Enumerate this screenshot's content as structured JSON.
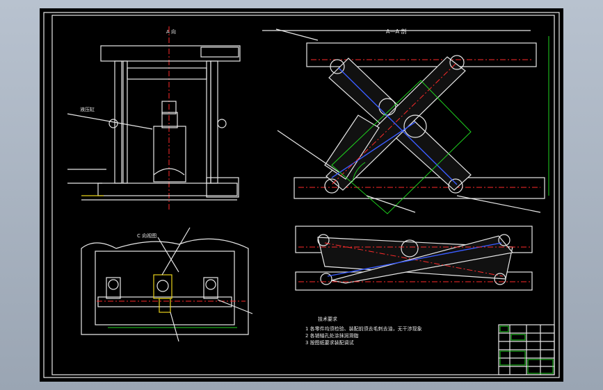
{
  "views": {
    "front_view_label": "C 向视图",
    "section_label": "A—A 剖",
    "arrow_label": "A 向"
  },
  "notes": {
    "title": "技术要求",
    "items": [
      "1 各零件均须检验、装配前须去毛刺去油，无干涉现象",
      "2 各销轴孔处涂抹润滑脂",
      "3 按图纸要求装配调试"
    ]
  },
  "title_block": {
    "rows": 6
  },
  "colors": {
    "sheet": "#000000",
    "outline": "#e8e8e8",
    "center_line": "#ff2a2a",
    "hydraulic": "#3a5cff",
    "dimension": "#1fd31f",
    "highlight": "#e8d21a"
  }
}
